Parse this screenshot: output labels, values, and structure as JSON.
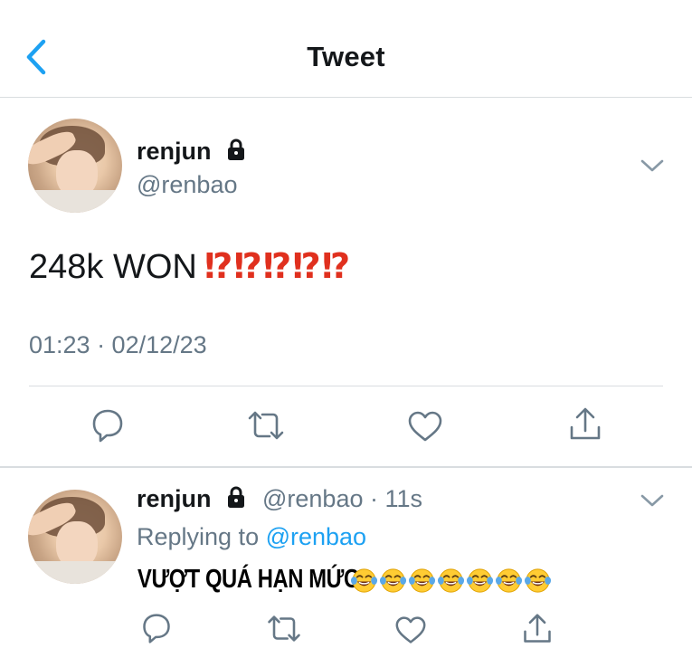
{
  "header": {
    "title": "Tweet",
    "back_icon": "chevron-left-icon"
  },
  "tweet": {
    "name": "renjun",
    "handle": "@renbao",
    "text": "248k WON",
    "emphasis": "⁉⁉⁉⁉⁉",
    "timestamp": "01:23 · 02/12/23"
  },
  "reply": {
    "name": "renjun",
    "meta": "@renbao · 11s",
    "replying_prefix": "Replying to ",
    "replying_handle": "@renbao",
    "overlay_caption": "VƯỢT QUÁ HẠN MỨC",
    "emoji_count": 7
  },
  "colors": {
    "accent": "#1da1f2",
    "secondary_text": "#657786",
    "divider": "#d9dde0",
    "emphasis_red": "#e0301e"
  }
}
